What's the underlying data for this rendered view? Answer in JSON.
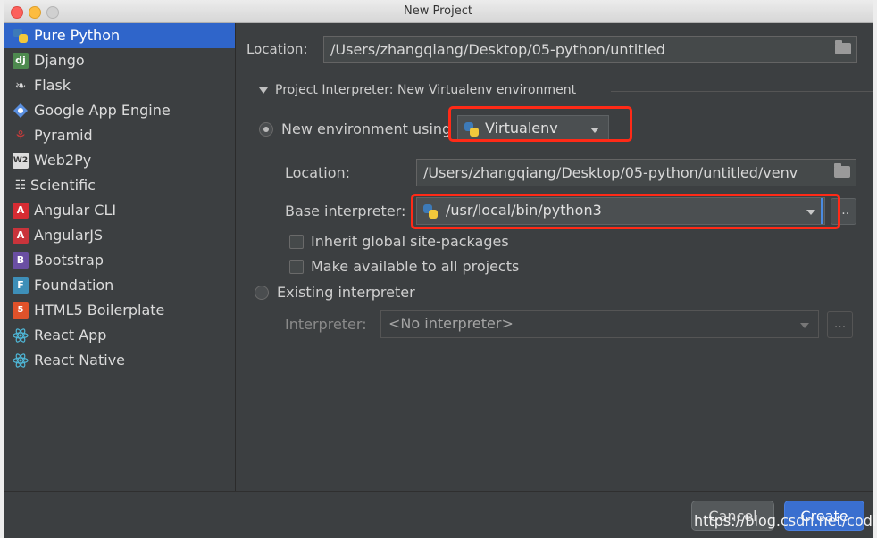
{
  "window": {
    "title": "New Project"
  },
  "sidebar": {
    "items": [
      {
        "label": "Pure Python",
        "icon": "python-icon",
        "selected": true
      },
      {
        "label": "Django",
        "icon": "django-icon"
      },
      {
        "label": "Flask",
        "icon": "flask-icon"
      },
      {
        "label": "Google App Engine",
        "icon": "google-app-engine-icon"
      },
      {
        "label": "Pyramid",
        "icon": "pyramid-icon"
      },
      {
        "label": "Web2Py",
        "icon": "web2py-icon"
      },
      {
        "label": "Scientific",
        "icon": "scientific-icon"
      },
      {
        "label": "Angular CLI",
        "icon": "angular-cli-icon"
      },
      {
        "label": "AngularJS",
        "icon": "angularjs-icon"
      },
      {
        "label": "Bootstrap",
        "icon": "bootstrap-icon"
      },
      {
        "label": "Foundation",
        "icon": "foundation-icon"
      },
      {
        "label": "HTML5 Boilerplate",
        "icon": "html5-icon"
      },
      {
        "label": "React App",
        "icon": "react-icon"
      },
      {
        "label": "React Native",
        "icon": "react-icon"
      }
    ]
  },
  "main": {
    "location_label": "Location:",
    "location_value": "/Users/zhangqiang/Desktop/05-python/untitled",
    "interpreter_section": "Project Interpreter: New Virtualenv environment",
    "new_env": {
      "radio_label": "New environment using",
      "tool": "Virtualenv",
      "location_label": "Location:",
      "location_value": "/Users/zhangqiang/Desktop/05-python/untitled/venv",
      "base_label": "Base interpreter:",
      "base_value": "/usr/local/bin/python3",
      "inherit_label": "Inherit global site-packages",
      "available_label": "Make available to all projects"
    },
    "existing": {
      "radio_label": "Existing interpreter",
      "interpreter_label": "Interpreter:",
      "interpreter_value": "<No interpreter>"
    },
    "ellipsis": "..."
  },
  "footer": {
    "cancel": "Cancel",
    "create": "Create"
  },
  "watermark": "https://blog.csdn.net/codipy",
  "colors": {
    "accent": "#2f65ca",
    "highlight": "#ff2a17",
    "background": "#3c3f41"
  }
}
